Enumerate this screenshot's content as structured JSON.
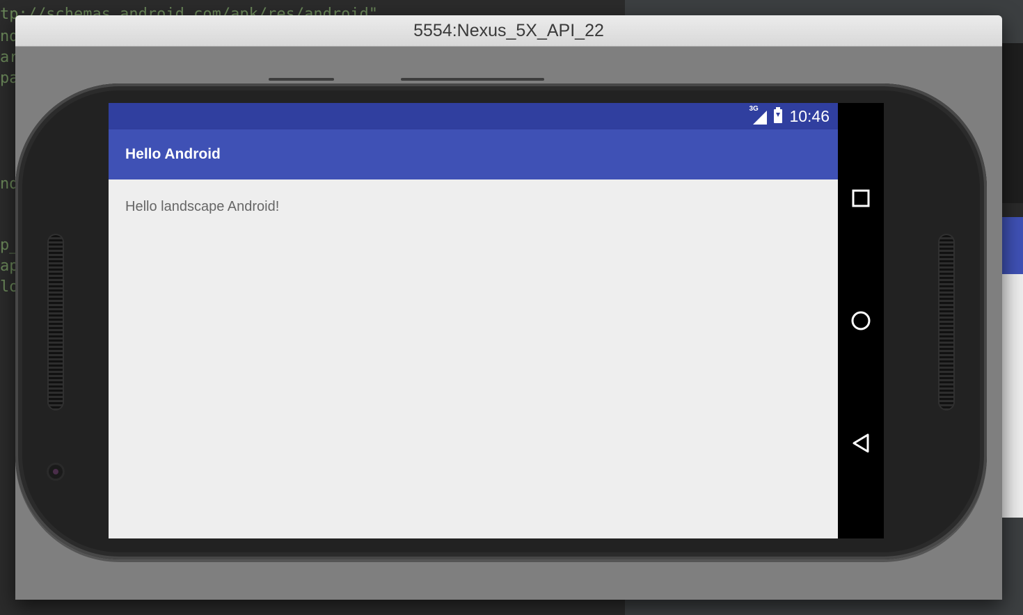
{
  "ide": {
    "code_lines": [
      "tp://schemas.android.com/apk/res/android\"",
      "nd",
      "ar",
      "pa",
      "nd",
      "p_",
      "ap",
      "lo"
    ]
  },
  "emulator": {
    "window_title": "5554:Nexus_5X_API_22"
  },
  "status_bar": {
    "network_label": "3G",
    "time": "10:46",
    "color": "#303f9f"
  },
  "app": {
    "title": "Hello Android",
    "primary_color": "#3f51b5",
    "message": "Hello landscape Android!"
  },
  "nav_bar": {
    "items": [
      {
        "icon": "recents-square-icon"
      },
      {
        "icon": "home-circle-icon"
      },
      {
        "icon": "back-triangle-icon"
      }
    ]
  }
}
